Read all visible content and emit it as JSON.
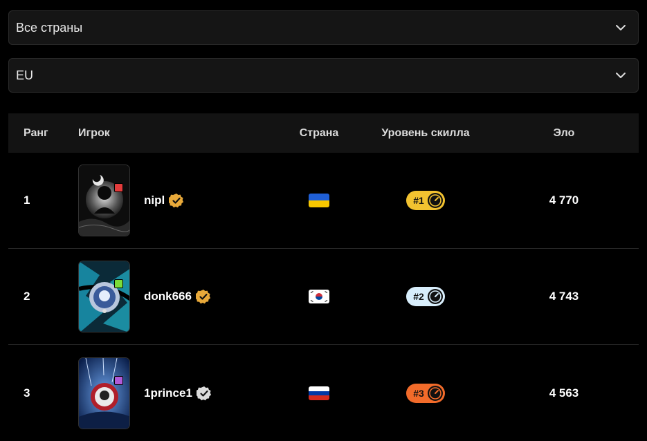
{
  "filters": {
    "country": {
      "value": "Все страны"
    },
    "region": {
      "value": "EU"
    }
  },
  "table": {
    "headers": {
      "rank": "Ранг",
      "player": "Игрок",
      "country": "Страна",
      "skill": "Уровень скилла",
      "elo": "Эло"
    },
    "rows": [
      {
        "rank": "1",
        "player": "nipl",
        "verified_color": "#e8a93a",
        "country_flag": "ukraine-flag",
        "skill_label": "#1",
        "skill_color": "#f2c230",
        "elo": "4 770",
        "avatar_badge_color": "#e23b3b"
      },
      {
        "rank": "2",
        "player": "donk666",
        "verified_color": "#e8a93a",
        "country_flag": "south-korea-flag",
        "skill_label": "#2",
        "skill_color": "#d8eefc",
        "elo": "4 743",
        "avatar_badge_color": "#7bdc3a"
      },
      {
        "rank": "3",
        "player": "1prince1",
        "verified_color": "#dcdcdc",
        "country_flag": "russia-flag",
        "skill_label": "#3",
        "skill_color": "#f26b2a",
        "elo": "4 563",
        "avatar_badge_color": "#b05ad8"
      }
    ]
  }
}
